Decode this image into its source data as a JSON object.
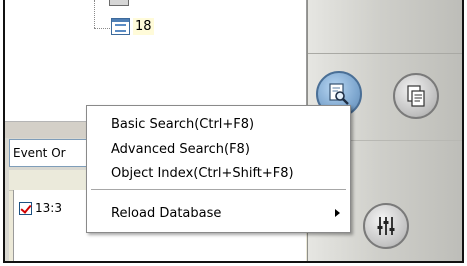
{
  "tree": {
    "node_label": "18"
  },
  "event_combo": {
    "value": "Event Or"
  },
  "event_list": {
    "rows": [
      {
        "time": "13:3",
        "checked": true
      }
    ]
  },
  "context_menu": {
    "items": [
      {
        "label": "Basic Search(Ctrl+F8)"
      },
      {
        "label": "Advanced Search(F8)"
      },
      {
        "label": "Object Index(Ctrl+Shift+F8)"
      },
      {
        "label": "Reload Database",
        "has_submenu": true
      }
    ]
  },
  "toolbar": {
    "buttons": [
      {
        "icon": "search-document-icon"
      },
      {
        "icon": "copy-pages-icon"
      },
      {
        "icon": "mixer-sliders-icon"
      }
    ]
  },
  "colors": {
    "check_mark": "#d20000",
    "search_button": "#7ea7cf",
    "tree_highlight": "#fffbd9"
  }
}
